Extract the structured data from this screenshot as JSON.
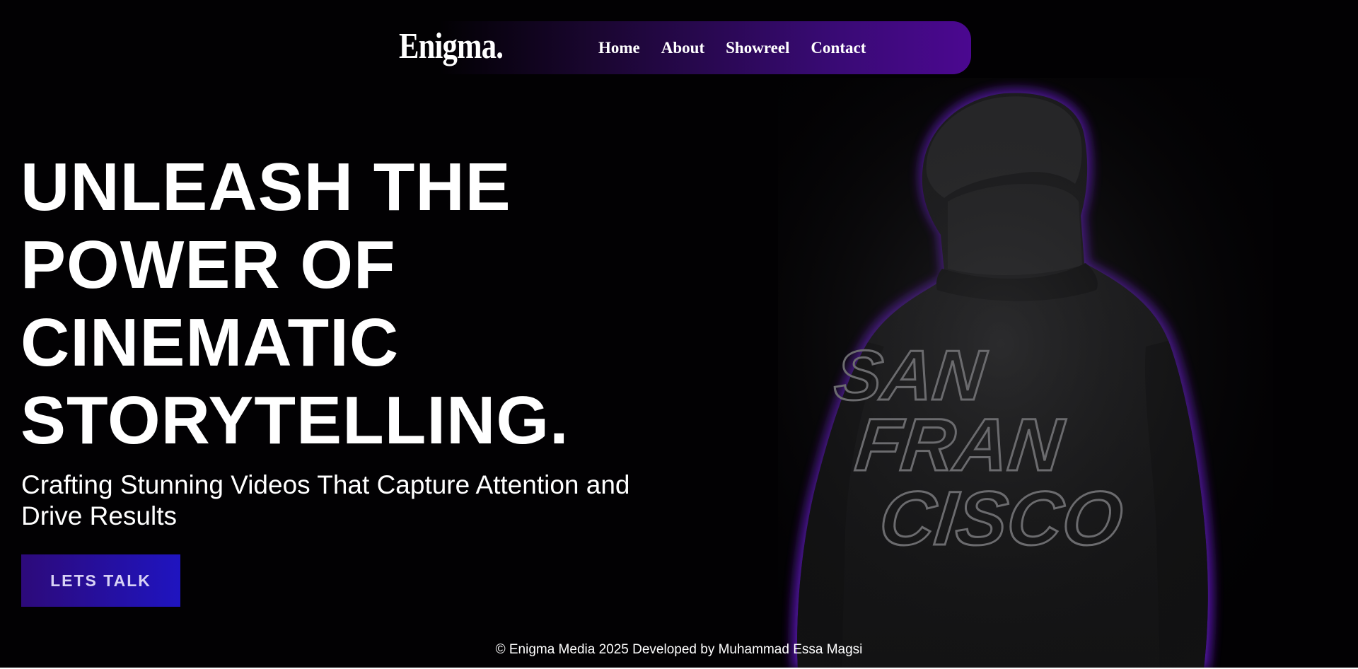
{
  "navbar": {
    "logo": "Enigma.",
    "links": [
      {
        "label": "Home"
      },
      {
        "label": "About"
      },
      {
        "label": "Showreel"
      },
      {
        "label": "Contact"
      }
    ]
  },
  "hero": {
    "title_lines": [
      "UNLEASH THE",
      "POWER OF",
      "CINEMATIC",
      "STORYTELLING."
    ],
    "subtitle": "Crafting Stunning Videos That Capture Attention and Drive Results",
    "cta_label": "LETS TALK"
  },
  "figure": {
    "jacket_text": [
      "SAN",
      "FRAN",
      "CISCO"
    ]
  },
  "footer": {
    "text": "© Enigma Media 2025 Developed by Muhammad Essa Magsi"
  },
  "colors": {
    "background": "#020103",
    "accent_purple": "#4b0890",
    "cta_blue": "#1f14c0",
    "text": "#ffffff"
  }
}
